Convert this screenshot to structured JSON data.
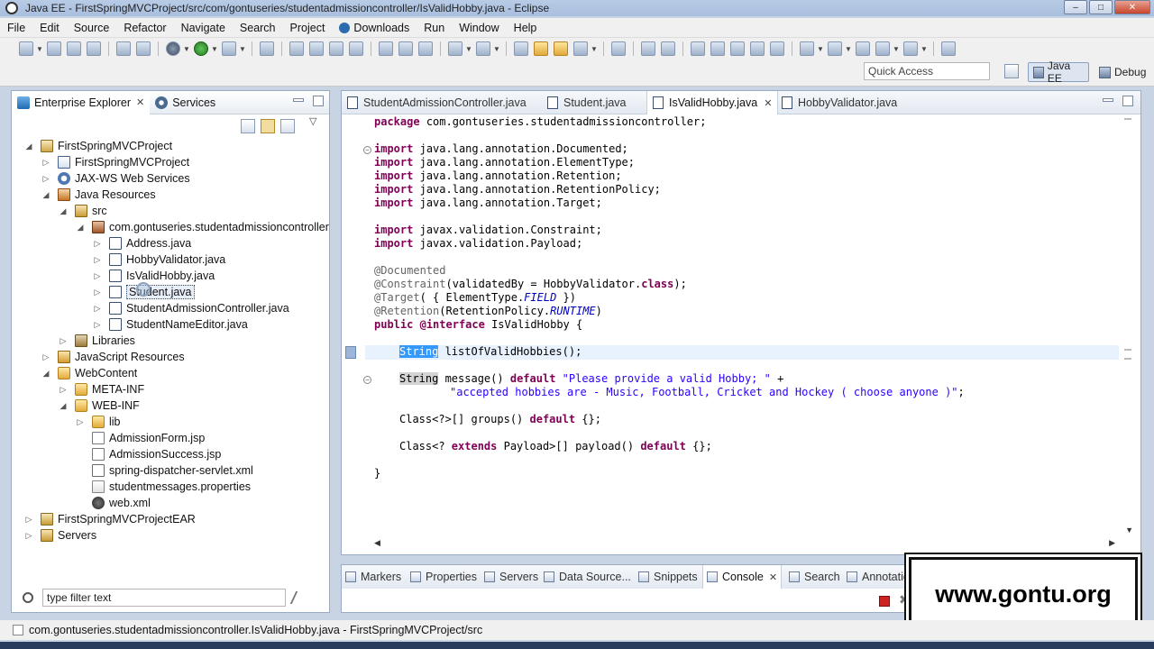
{
  "window": {
    "title": "Java EE - FirstSpringMVCProject/src/com/gontuseries/studentadmissioncontroller/IsValidHobby.java - Eclipse"
  },
  "menu": [
    "File",
    "Edit",
    "Source",
    "Refactor",
    "Navigate",
    "Search",
    "Project",
    "Downloads",
    "Run",
    "Window",
    "Help"
  ],
  "toolbar": {
    "quick_access": "Quick Access",
    "perspectives": {
      "active": "Java EE",
      "other": "Debug"
    }
  },
  "explorer": {
    "tabs": {
      "enterprise": "Enterprise Explorer",
      "services": "Services"
    },
    "tree": [
      {
        "label": "FirstSpringMVCProject",
        "icon": "project-icon",
        "state": "expanded"
      },
      {
        "label": "FirstSpringMVCProject",
        "icon": "deployment-descriptor-icon",
        "state": "collapsed"
      },
      {
        "label": "JAX-WS Web Services",
        "icon": "web-services-icon",
        "state": "collapsed"
      },
      {
        "label": "Java Resources",
        "icon": "java-resources-icon",
        "state": "expanded"
      },
      {
        "label": "src",
        "icon": "source-folder-icon",
        "state": "expanded"
      },
      {
        "label": "com.gontuseries.studentadmissioncontroller",
        "icon": "package-icon",
        "state": "expanded"
      },
      {
        "label": "Address.java",
        "icon": "java-file-icon",
        "state": "collapsed"
      },
      {
        "label": "HobbyValidator.java",
        "icon": "java-file-icon",
        "state": "collapsed"
      },
      {
        "label": "IsValidHobby.java",
        "icon": "java-file-icon",
        "state": "collapsed"
      },
      {
        "label": "Student.java",
        "icon": "java-file-icon",
        "state": "collapsed",
        "selected": true
      },
      {
        "label": "StudentAdmissionController.java",
        "icon": "java-file-icon",
        "state": "collapsed"
      },
      {
        "label": "StudentNameEditor.java",
        "icon": "java-file-icon",
        "state": "collapsed"
      },
      {
        "label": "Libraries",
        "icon": "libraries-icon",
        "state": "collapsed"
      },
      {
        "label": "JavaScript Resources",
        "icon": "javascript-resources-icon",
        "state": "collapsed"
      },
      {
        "label": "WebContent",
        "icon": "folder-icon",
        "state": "expanded"
      },
      {
        "label": "META-INF",
        "icon": "folder-icon",
        "state": "collapsed"
      },
      {
        "label": "WEB-INF",
        "icon": "folder-icon",
        "state": "expanded"
      },
      {
        "label": "lib",
        "icon": "folder-icon",
        "state": "collapsed"
      },
      {
        "label": "AdmissionForm.jsp",
        "icon": "jsp-file-icon",
        "state": "leaf"
      },
      {
        "label": "AdmissionSuccess.jsp",
        "icon": "jsp-file-icon",
        "state": "leaf"
      },
      {
        "label": "spring-dispatcher-servlet.xml",
        "icon": "xml-file-icon",
        "state": "leaf"
      },
      {
        "label": "studentmessages.properties",
        "icon": "properties-file-icon",
        "state": "leaf"
      },
      {
        "label": "web.xml",
        "icon": "web-xml-icon",
        "state": "leaf"
      },
      {
        "label": "FirstSpringMVCProjectEAR",
        "icon": "ear-project-icon",
        "state": "collapsed"
      },
      {
        "label": "Servers",
        "icon": "servers-icon",
        "state": "collapsed"
      }
    ],
    "filter_placeholder": "type filter text"
  },
  "editor": {
    "tabs": [
      "StudentAdmissionController.java",
      "Student.java",
      "IsValidHobby.java",
      "HobbyValidator.java"
    ],
    "active_tab": "IsValidHobby.java",
    "code": {
      "l1": "com.gontuseries.studentadmissioncontroller;",
      "imp1": "java.lang.annotation.Documented;",
      "imp2": "java.lang.annotation.ElementType;",
      "imp3": "java.lang.annotation.Retention;",
      "imp4": "java.lang.annotation.RetentionPolicy;",
      "imp5": "java.lang.annotation.Target;",
      "imp6": "javax.validation.Constraint;",
      "imp7": "javax.validation.Payload;",
      "a1": "@Documented",
      "a2_ann": "@Constraint",
      "a2_rest": "(validatedBy = HobbyValidator.",
      "a2_end": ");",
      "a3_ann": "@Target",
      "a3_rest": "( { ElementType.",
      "a3_const": "FIELD",
      "a3_end": " })",
      "a4_ann": "@Retention",
      "a4_rest": "(RetentionPolicy.",
      "a4_const": "RUNTIME",
      "a4_end": ")",
      "decl_name": " IsValidHobby {",
      "m1_type": "String",
      "m1_rest": " listOfValidHobbies();",
      "m2_type": "String",
      "m2_rest": " message() ",
      "m2_str": "\"Please provide a valid Hobby; \"",
      "m2_plus": " +",
      "m2_str2": "\"accepted hobbies are - Music, Football, Cricket and Hockey ( choose anyone )\"",
      "m2_end": ";",
      "m3_rest": "Class<?>[] groups() ",
      "m3_end": " {};",
      "m4_a": "Class<? ",
      "m4_b": " Payload>[] payload() ",
      "m4_end": " {};",
      "close": "}"
    }
  },
  "bottom_panel": {
    "tabs": [
      "Markers",
      "Properties",
      "Servers",
      "Data Source...",
      "Snippets",
      "Console",
      "Search",
      "Annotatio"
    ],
    "active_tab": "Console"
  },
  "watermark": "www.gontu.org",
  "status": {
    "text": "com.gontuseries.studentadmissioncontroller.IsValidHobby.java - FirstSpringMVCProject/src"
  }
}
